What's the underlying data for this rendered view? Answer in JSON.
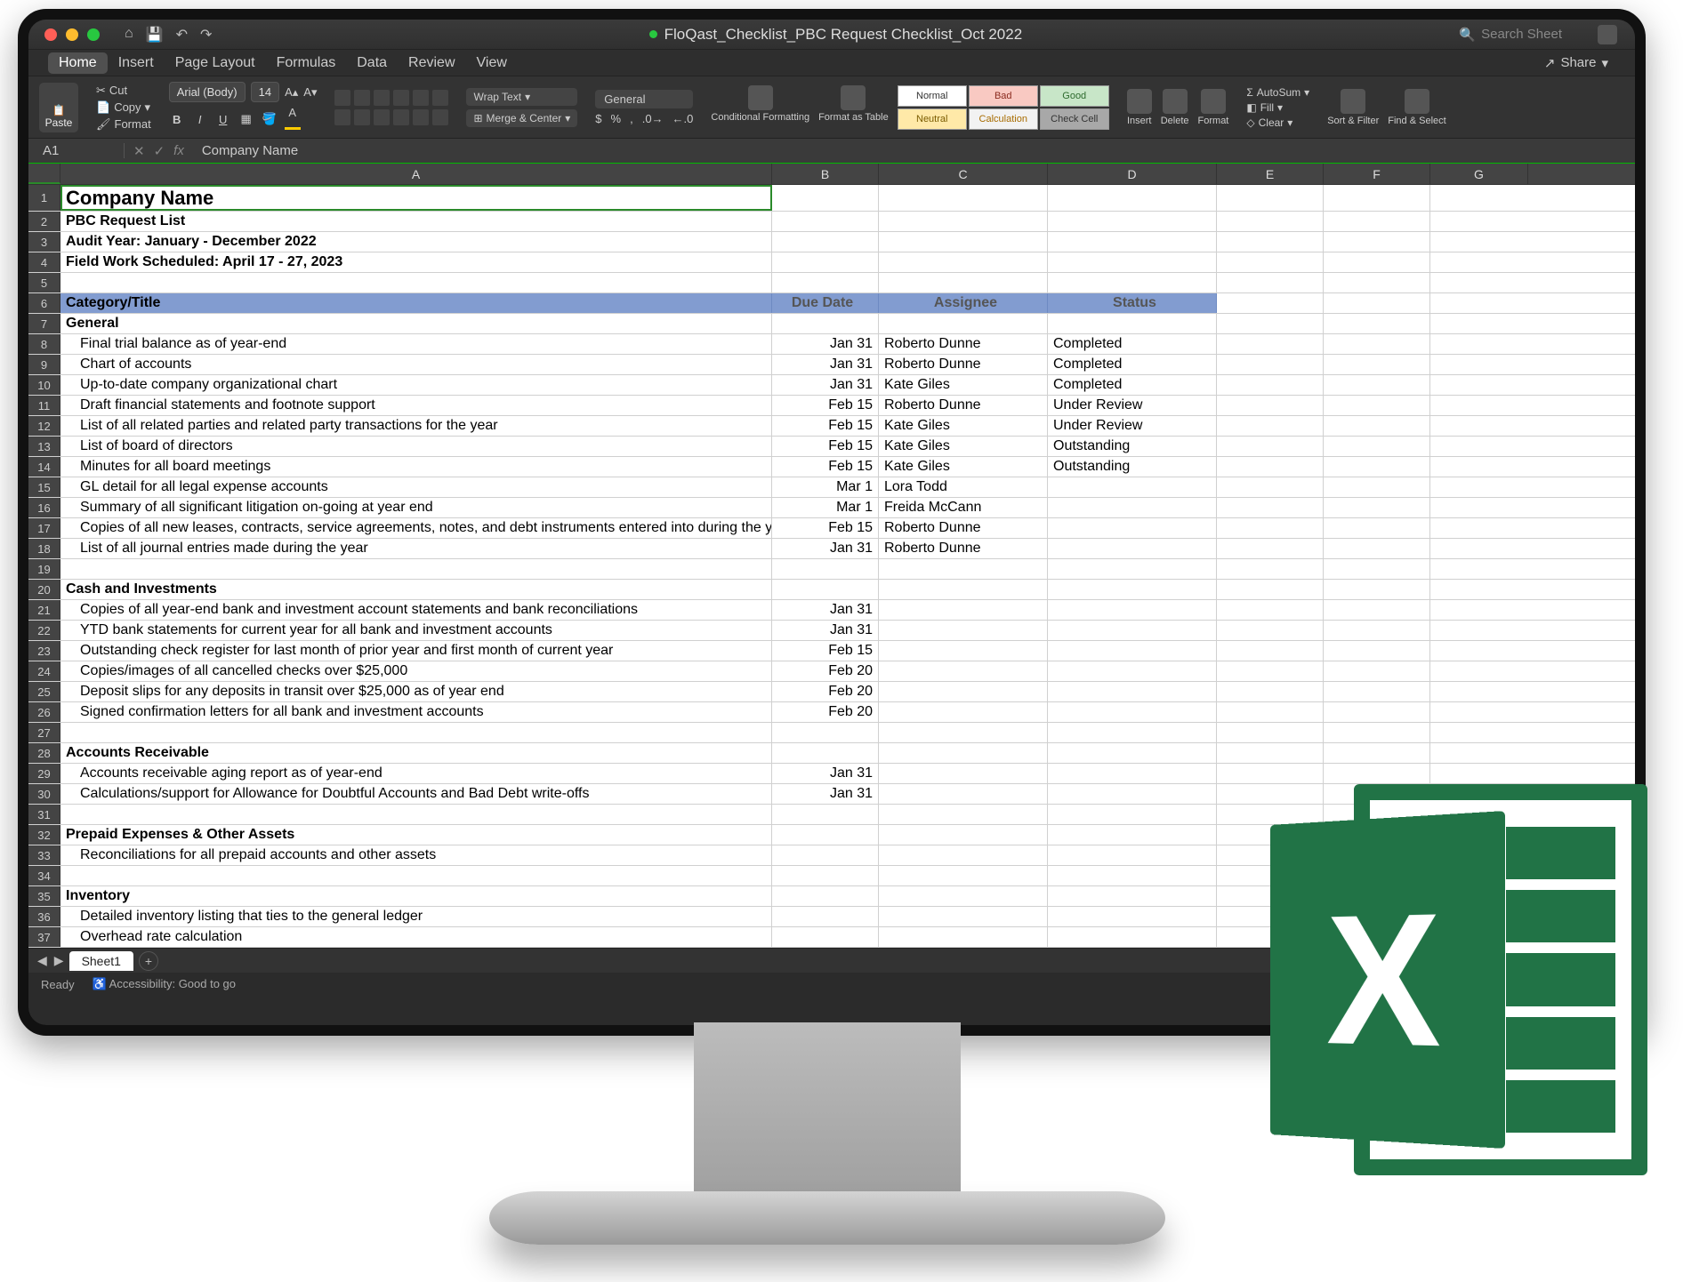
{
  "titlebar": {
    "filename": "FloQast_Checklist_PBC Request Checklist_Oct 2022",
    "search_placeholder": "Search Sheet"
  },
  "menu": {
    "tabs": [
      "Home",
      "Insert",
      "Page Layout",
      "Formulas",
      "Data",
      "Review",
      "View"
    ],
    "share": "Share"
  },
  "ribbon": {
    "paste": "Paste",
    "cut": "Cut",
    "copy": "Copy",
    "format_painter": "Format",
    "font_name": "Arial (Body)",
    "font_size": "14",
    "wrap": "Wrap Text",
    "merge": "Merge & Center",
    "number_format": "General",
    "cond_fmt": "Conditional Formatting",
    "fmt_table": "Format as Table",
    "styles": {
      "normal": "Normal",
      "bad": "Bad",
      "good": "Good",
      "neutral": "Neutral",
      "calc": "Calculation",
      "check": "Check Cell"
    },
    "insert": "Insert",
    "delete": "Delete",
    "format": "Format",
    "autosum": "AutoSum",
    "fill": "Fill",
    "clear": "Clear",
    "sort": "Sort & Filter",
    "find": "Find & Select"
  },
  "formula_bar": {
    "cell_ref": "A1",
    "value": "Company Name"
  },
  "columns": [
    "A",
    "B",
    "C",
    "D",
    "E",
    "F",
    "G"
  ],
  "rows": [
    {
      "n": 1,
      "a": "Company Name",
      "bold": true,
      "big": true,
      "sel": true
    },
    {
      "n": 2,
      "a": "PBC Request List",
      "bold": true
    },
    {
      "n": 3,
      "a": "Audit Year: January - December 2022",
      "bold": true
    },
    {
      "n": 4,
      "a": "Field Work Scheduled: April 17 - 27, 2023",
      "bold": true
    },
    {
      "n": 5
    },
    {
      "n": 6,
      "hdr": true,
      "a": "Category/Title",
      "b": "Due Date",
      "c": "Assignee",
      "d": "Status"
    },
    {
      "n": 7,
      "a": "General",
      "bold": true
    },
    {
      "n": 8,
      "a": "Final trial balance as of year-end",
      "b": "Jan 31",
      "c": "Roberto Dunne",
      "d": "Completed",
      "indent": true
    },
    {
      "n": 9,
      "a": "Chart of accounts",
      "b": "Jan 31",
      "c": "Roberto Dunne",
      "d": "Completed",
      "indent": true
    },
    {
      "n": 10,
      "a": "Up-to-date company organizational chart",
      "b": "Jan 31",
      "c": "Kate Giles",
      "d": "Completed",
      "indent": true
    },
    {
      "n": 11,
      "a": "Draft financial statements and footnote support",
      "b": "Feb 15",
      "c": "Roberto Dunne",
      "d": "Under Review",
      "indent": true
    },
    {
      "n": 12,
      "a": "List of all related parties and related party transactions for the year",
      "b": "Feb 15",
      "c": "Kate Giles",
      "d": "Under Review",
      "indent": true
    },
    {
      "n": 13,
      "a": "List of board of directors",
      "b": "Feb 15",
      "c": "Kate Giles",
      "d": "Outstanding",
      "indent": true
    },
    {
      "n": 14,
      "a": "Minutes for all board meetings",
      "b": "Feb 15",
      "c": "Kate Giles",
      "d": "Outstanding",
      "indent": true
    },
    {
      "n": 15,
      "a": "GL detail for all legal expense accounts",
      "b": "Mar 1",
      "c": "Lora Todd",
      "indent": true
    },
    {
      "n": 16,
      "a": "Summary of all significant litigation on-going at year end",
      "b": "Mar 1",
      "c": "Freida McCann",
      "indent": true
    },
    {
      "n": 17,
      "a": "Copies of all new leases, contracts, service agreements, notes, and debt instruments entered into during the year",
      "b": "Feb 15",
      "c": "Roberto Dunne",
      "indent": true
    },
    {
      "n": 18,
      "a": "List of all journal entries made during the year",
      "b": "Jan 31",
      "c": "Roberto Dunne",
      "indent": true
    },
    {
      "n": 19
    },
    {
      "n": 20,
      "a": "Cash and Investments",
      "bold": true
    },
    {
      "n": 21,
      "a": "Copies of all year-end bank and investment account statements and bank reconciliations",
      "b": "Jan 31",
      "indent": true
    },
    {
      "n": 22,
      "a": "YTD bank statements for current year for all bank and investment accounts",
      "b": "Jan 31",
      "indent": true
    },
    {
      "n": 23,
      "a": "Outstanding check register for last month of prior year and first month of current year",
      "b": "Feb 15",
      "indent": true
    },
    {
      "n": 24,
      "a": "Copies/images of all cancelled checks over $25,000",
      "b": "Feb 20",
      "indent": true
    },
    {
      "n": 25,
      "a": "Deposit slips for any deposits in transit over $25,000 as of year end",
      "b": "Feb 20",
      "indent": true
    },
    {
      "n": 26,
      "a": "Signed confirmation letters for all bank and investment accounts",
      "b": "Feb 20",
      "indent": true
    },
    {
      "n": 27
    },
    {
      "n": 28,
      "a": "Accounts Receivable",
      "bold": true
    },
    {
      "n": 29,
      "a": "Accounts receivable aging report as of year-end",
      "b": "Jan 31",
      "indent": true
    },
    {
      "n": 30,
      "a": "Calculations/support for Allowance for Doubtful Accounts and Bad Debt write-offs",
      "b": "Jan 31",
      "indent": true
    },
    {
      "n": 31
    },
    {
      "n": 32,
      "a": "Prepaid Expenses & Other Assets",
      "bold": true
    },
    {
      "n": 33,
      "a": "Reconciliations for all prepaid accounts and other assets",
      "indent": true
    },
    {
      "n": 34
    },
    {
      "n": 35,
      "a": "Inventory",
      "bold": true
    },
    {
      "n": 36,
      "a": "Detailed inventory listing that ties to the general ledger",
      "indent": true
    },
    {
      "n": 37,
      "a": "Overhead rate calculation",
      "indent": true
    }
  ],
  "sheet_tab": "Sheet1",
  "status_bar": {
    "ready": "Ready",
    "access": "Accessibility: Good to go"
  }
}
